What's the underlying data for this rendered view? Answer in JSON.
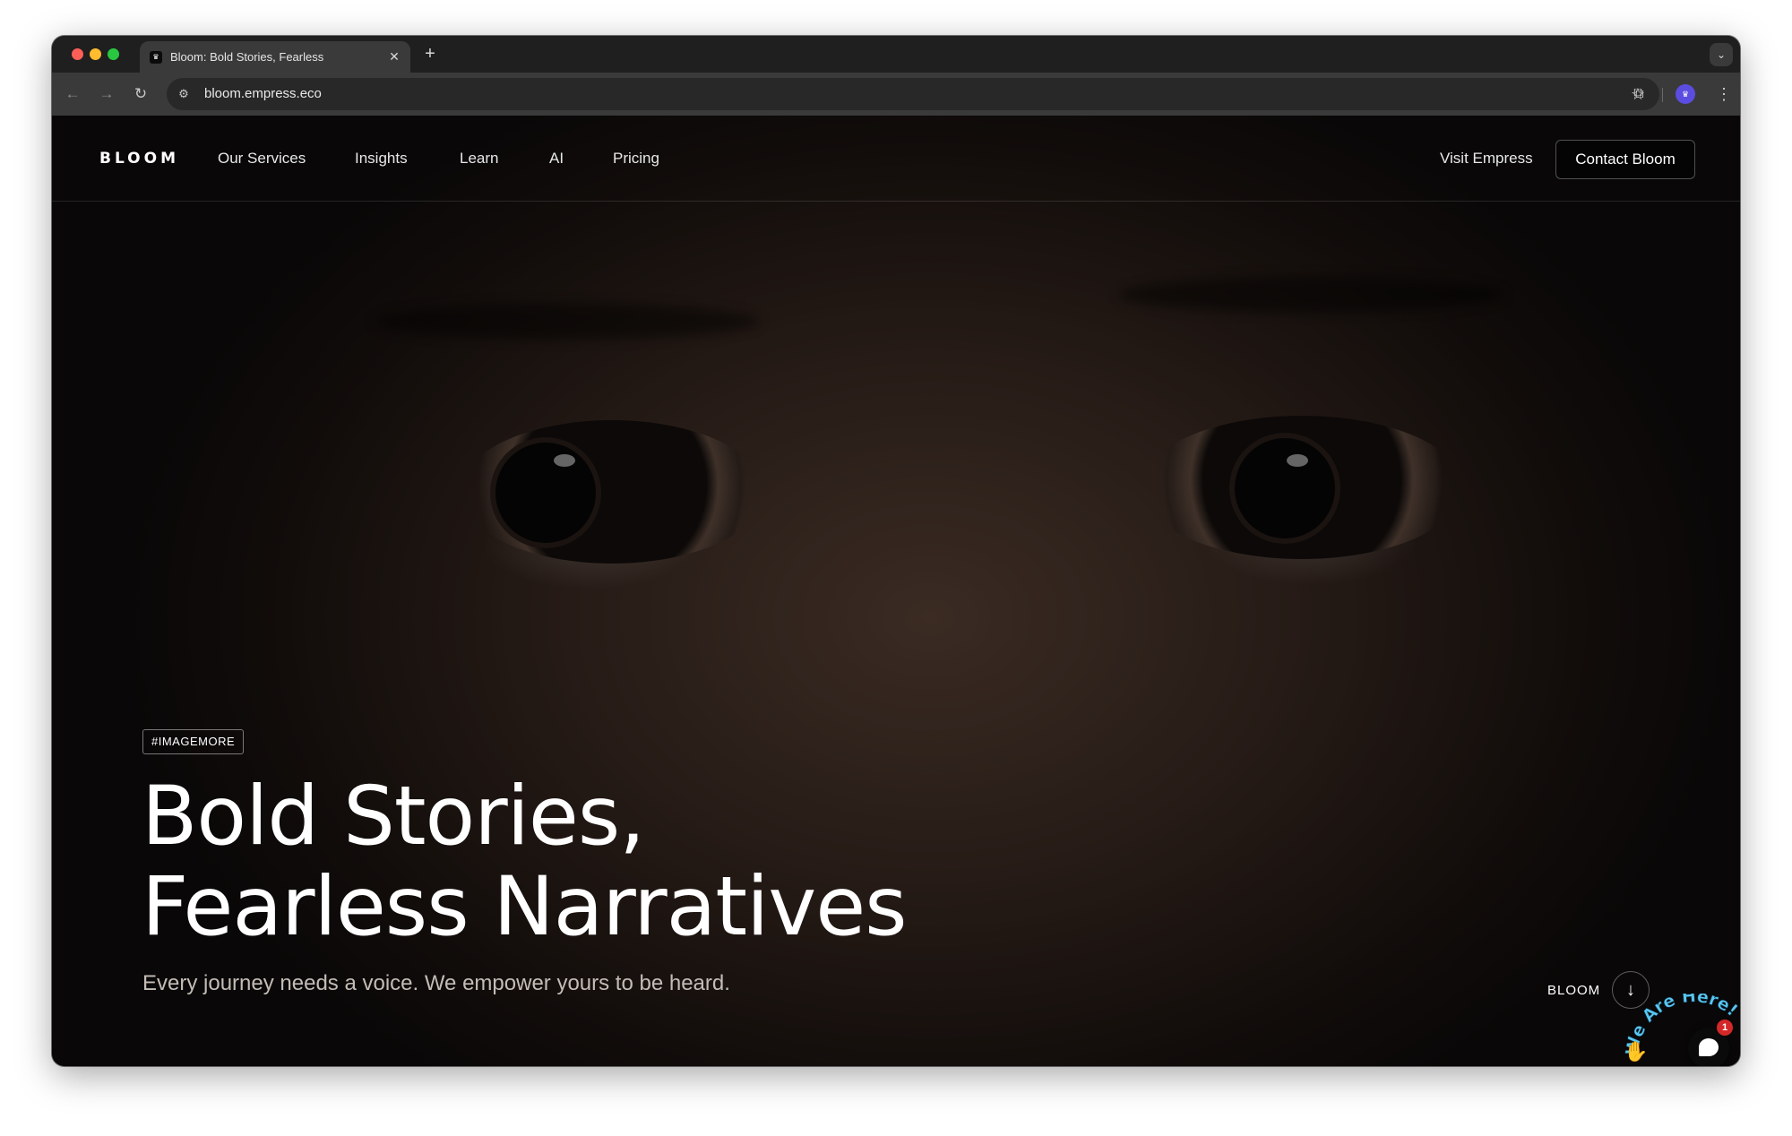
{
  "browser": {
    "tab": {
      "favicon": "bloom-favicon-icon",
      "title": "Bloom: Bold Stories, Fearless",
      "close_icon": "close-icon"
    },
    "new_tab_icon": "plus-icon",
    "tab_menu_icon": "chevron-down-icon",
    "toolbar": {
      "back_icon": "arrow-left-icon",
      "forward_icon": "arrow-right-icon",
      "reload_icon": "reload-icon",
      "site_info_icon": "site-info-icon",
      "url": "bloom.empress.eco",
      "bookmark_icon": "star-icon",
      "extensions_icon": "puzzle-icon",
      "menu_icon": "kebab-icon"
    }
  },
  "site": {
    "brand": "BLOOM",
    "nav": [
      {
        "label": "Our Services"
      },
      {
        "label": "Insights"
      },
      {
        "label": "Learn"
      },
      {
        "label": "AI"
      },
      {
        "label": "Pricing"
      }
    ],
    "visit_label": "Visit Empress",
    "contact_label": "Contact Bloom"
  },
  "hero": {
    "tag": "#IMAGEMORE",
    "title_line1": "Bold Stories,",
    "title_line2": "Fearless Narratives",
    "subtitle": "Every journey needs a voice. We empower yours to be heard.",
    "scroll_label": "BLOOM",
    "scroll_icon": "arrow-down-icon"
  },
  "chat": {
    "arc_text": "We Are Here!",
    "badge_count": "1",
    "wave_icon": "waving-hand-icon",
    "bubble_icon": "chat-bubble-icon"
  },
  "colors": {
    "page_background": "#0d0b0a",
    "chat_badge": "#d42828",
    "chat_arc_text": "#5bc7f0"
  }
}
